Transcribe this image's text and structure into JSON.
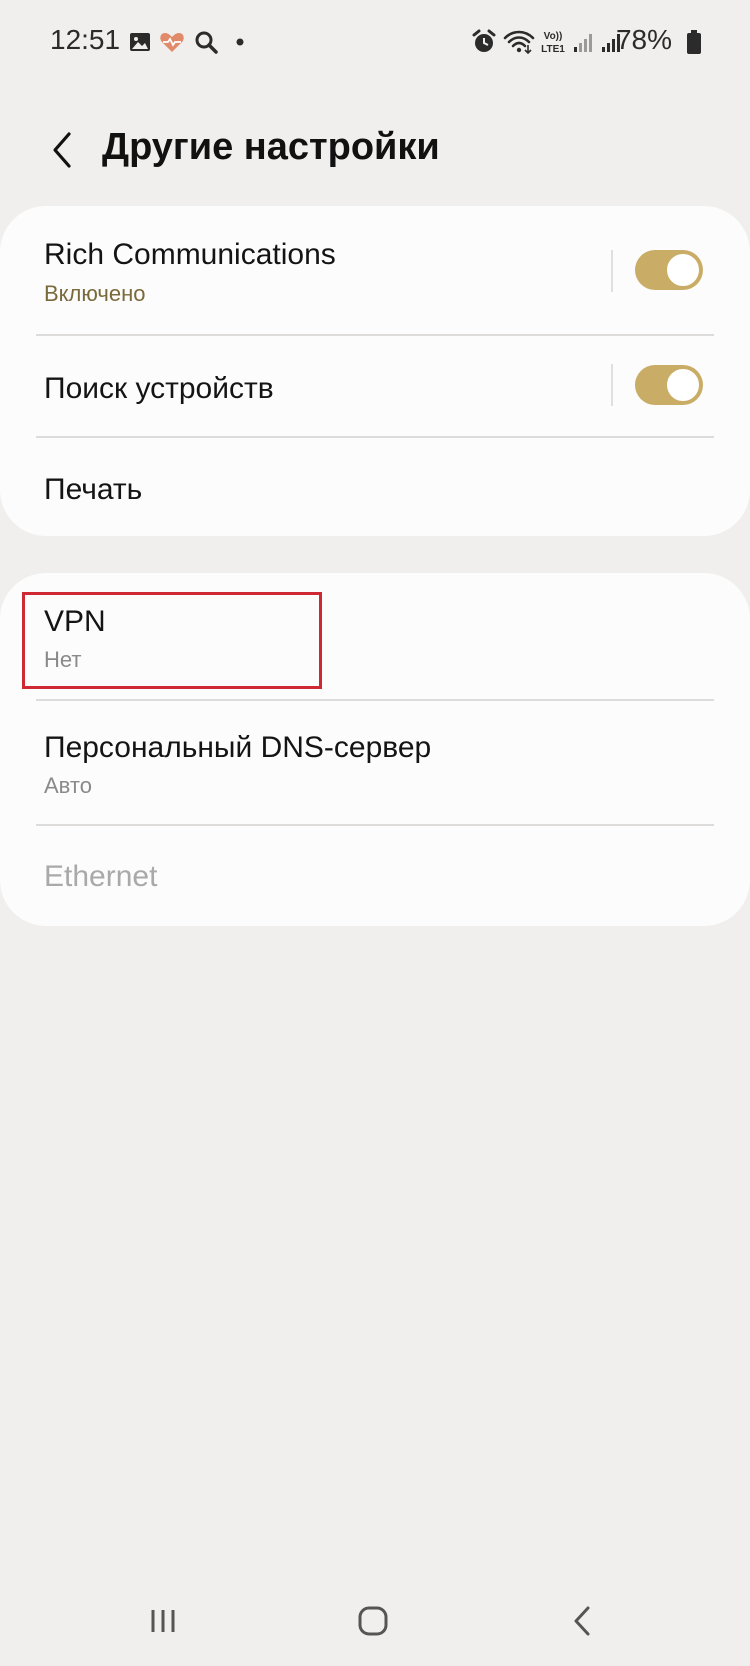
{
  "status_bar": {
    "time": "12:51",
    "battery_percent": "78%",
    "icons": [
      "gallery-icon",
      "health-icon",
      "search-icon",
      "notification-dot-icon",
      "alarm-icon",
      "wifi-icon",
      "volte-icon",
      "signal-icon",
      "signal-icon",
      "battery-icon"
    ],
    "volte_label": "Vo))\nLTE1"
  },
  "header": {
    "title": "Другие настройки",
    "back_icon": "chevron-left-icon"
  },
  "sections": [
    {
      "items": [
        {
          "title": "Rich Communications",
          "subtitle": "Включено",
          "toggle": true
        },
        {
          "title": "Поиск устройств",
          "toggle": true
        },
        {
          "title": "Печать"
        }
      ]
    },
    {
      "items": [
        {
          "title": "VPN",
          "subtitle": "Нет",
          "highlighted": true
        },
        {
          "title": "Персональный DNS-сервер",
          "subtitle": "Авто"
        },
        {
          "title": "Ethernet",
          "disabled": true
        }
      ]
    }
  ],
  "colors": {
    "background": "#f1efed",
    "card": "#fcfcfc",
    "toggle_on": "#c9ad66",
    "accent_subtitle": "#7a6a3a",
    "highlight": "#cf2a34"
  },
  "nav_bar": {
    "recents_icon": "recents-icon",
    "home_icon": "home-icon",
    "back_icon": "back-icon"
  }
}
